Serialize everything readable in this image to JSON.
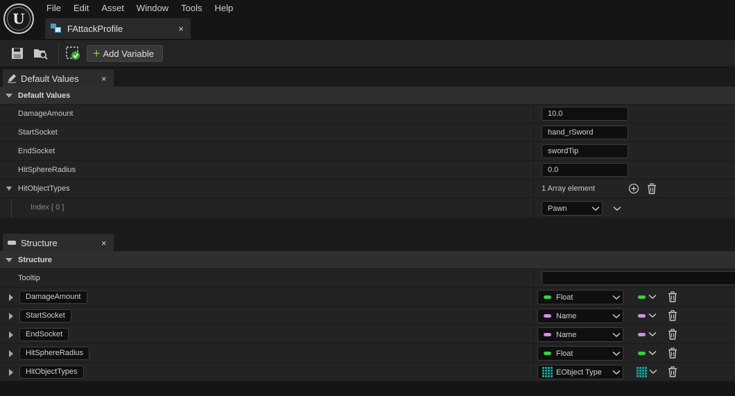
{
  "menu": [
    "File",
    "Edit",
    "Asset",
    "Window",
    "Tools",
    "Help"
  ],
  "document_tab": {
    "label": "FAttackProfile",
    "close": "×"
  },
  "toolbar": {
    "add_variable_label": "Add Variable"
  },
  "default_values_panel": {
    "tab_label": "Default Values",
    "tab_close": "×",
    "section_title": "Default Values",
    "rows": [
      {
        "name": "DamageAmount",
        "value": "10.0"
      },
      {
        "name": "StartSocket",
        "value": "hand_rSword"
      },
      {
        "name": "EndSocket",
        "value": "swordTip"
      },
      {
        "name": "HitSphereRadius",
        "value": "0.0"
      }
    ],
    "array_row": {
      "name": "HitObjectTypes",
      "summary": "1 Array element"
    },
    "array_element": {
      "name": "Index [ 0 ]",
      "value": "Pawn"
    }
  },
  "structure_panel": {
    "tab_label": "Structure",
    "tab_close": "×",
    "section_title": "Structure",
    "tooltip_label": "Tooltip",
    "variables": [
      {
        "name": "DamageAmount",
        "type": "Float",
        "color": "#3ad13a"
      },
      {
        "name": "StartSocket",
        "type": "Name",
        "color": "#d48ce8"
      },
      {
        "name": "EndSocket",
        "type": "Name",
        "color": "#d48ce8"
      },
      {
        "name": "HitSphereRadius",
        "type": "Float",
        "color": "#3ad13a"
      },
      {
        "name": "HitObjectTypes",
        "type": "EObject Type",
        "color": "#17a09a"
      }
    ]
  }
}
